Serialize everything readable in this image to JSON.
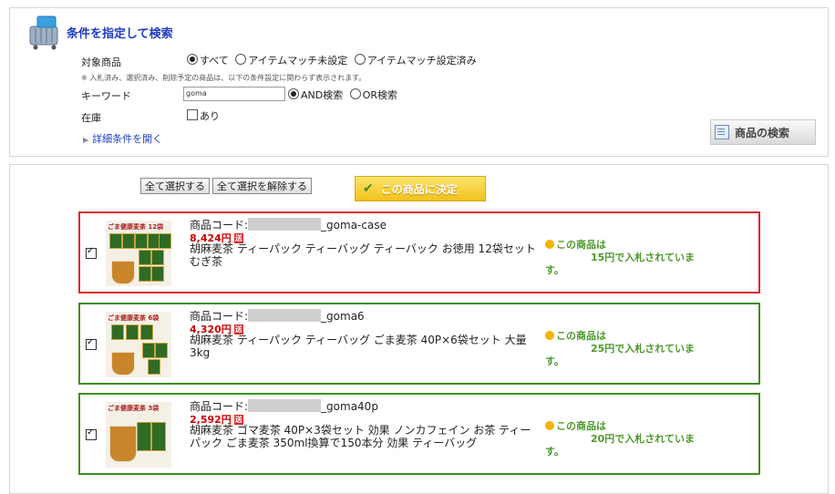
{
  "search": {
    "title": "条件を指定して検索",
    "target_label": "対象商品",
    "target_options": [
      {
        "label": "すべて",
        "selected": true
      },
      {
        "label": "アイテムマッチ未設定",
        "selected": false
      },
      {
        "label": "アイテムマッチ設定済み",
        "selected": false
      }
    ],
    "note": "※ 入札済み、選択済み、削除予定の商品は、以下の条件設定に関わらず表示されます。",
    "keyword_label": "キーワード",
    "keyword_value": "goma",
    "and_label": "AND検索",
    "or_label": "OR検索",
    "and_selected": true,
    "stock_label": "在庫",
    "stock_option": "あり",
    "stock_checked": false,
    "detail_link": "詳細条件を開く",
    "search_button": "商品の検索"
  },
  "results": {
    "select_all": "全て選択する",
    "deselect_all": "全て選択を解除する",
    "decide_button": "この商品に決定",
    "code_prefix": "商品コード:",
    "items": [
      {
        "code_suffix": "_goma-case",
        "price": "8,424円",
        "soku": "送",
        "name": "胡麻麦茶 ティーパック ティーバッグ ティーバック お徳用 12袋セット むぎ茶",
        "bid_line1": "この商品は",
        "bid_line2": "15円で入札されていま",
        "bid_line3": "す。",
        "thumb_title": "ごま健康麦茶 12袋",
        "checked": true,
        "border": "red"
      },
      {
        "code_suffix": "_goma6",
        "price": "4,320円",
        "soku": "送",
        "name": "胡麻麦茶 ティーパック ティーバッグ ごま麦茶 40P×6袋セット 大量3kg",
        "bid_line1": "この商品は",
        "bid_line2": "25円で入札されていま",
        "bid_line3": "す。",
        "thumb_title": "ごま健康麦茶 6袋",
        "checked": true,
        "border": "green"
      },
      {
        "code_suffix": "_goma40p",
        "price": "2,592円",
        "soku": "送",
        "name": "胡麻麦茶 ゴマ麦茶 40P×3袋セット 効果 ノンカフェイン お茶 ティーパック ごま麦茶 350ml換算で150本分 効果 ティーバッグ",
        "bid_line1": "この商品は",
        "bid_line2": "20円で入札されていま",
        "bid_line3": "す。",
        "thumb_title": "ごま健康麦茶 3袋",
        "checked": true,
        "border": "green"
      }
    ]
  },
  "colors": {
    "title": "#1f3ec2",
    "price": "#cc0000",
    "bid": "#4c9a2a",
    "red_border": "#e0262b",
    "green_border": "#3b8f1c"
  }
}
